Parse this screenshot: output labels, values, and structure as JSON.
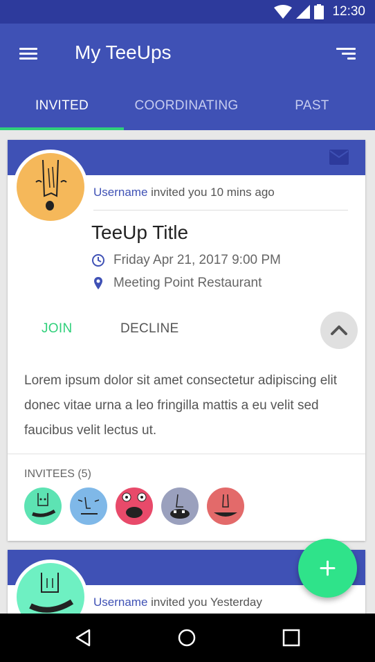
{
  "status_bar": {
    "time": "12:30",
    "icons": [
      "wifi-icon",
      "signal-icon",
      "battery-icon"
    ]
  },
  "app_bar": {
    "title": "My TeeUps",
    "left_icon": "menu-icon",
    "right_icon": "sort-icon"
  },
  "tabs": [
    {
      "label": "INVITED",
      "active": true
    },
    {
      "label": "COORDINATING",
      "active": false
    },
    {
      "label": "PAST",
      "active": false
    }
  ],
  "cards": [
    {
      "username": "Username",
      "invite_text": " invited you 10 mins ago",
      "title": "TeeUp Title",
      "datetime": "Friday Apr 21, 2017 9:00 PM",
      "location": "Meeting Point Restaurant",
      "join_label": "JOIN",
      "decline_label": "DECLINE",
      "description": "Lorem ipsum dolor sit amet consectetur adipiscing elit donec vitae urna a leo fringilla mattis a eu velit sed faucibus velit lectus ut.",
      "invitees_label": "INVITEES (5)",
      "avatar_color": "#f5b85a",
      "invitee_colors": [
        "#5de3b3",
        "#7fb8e8",
        "#e84a6a",
        "#9aa0bd",
        "#e36a6a"
      ]
    },
    {
      "username": "Username",
      "invite_text": " invited you Yesterday",
      "avatar_color": "#6ef0c2"
    }
  ],
  "colors": {
    "primary": "#3f51b5",
    "primary_dark": "#2d3a9c",
    "accent": "#2fe38a",
    "join": "#2fd07a"
  },
  "nav_bar": {
    "icons": [
      "back-icon",
      "home-icon",
      "recents-icon"
    ]
  },
  "fab": {
    "icon": "plus-icon"
  }
}
